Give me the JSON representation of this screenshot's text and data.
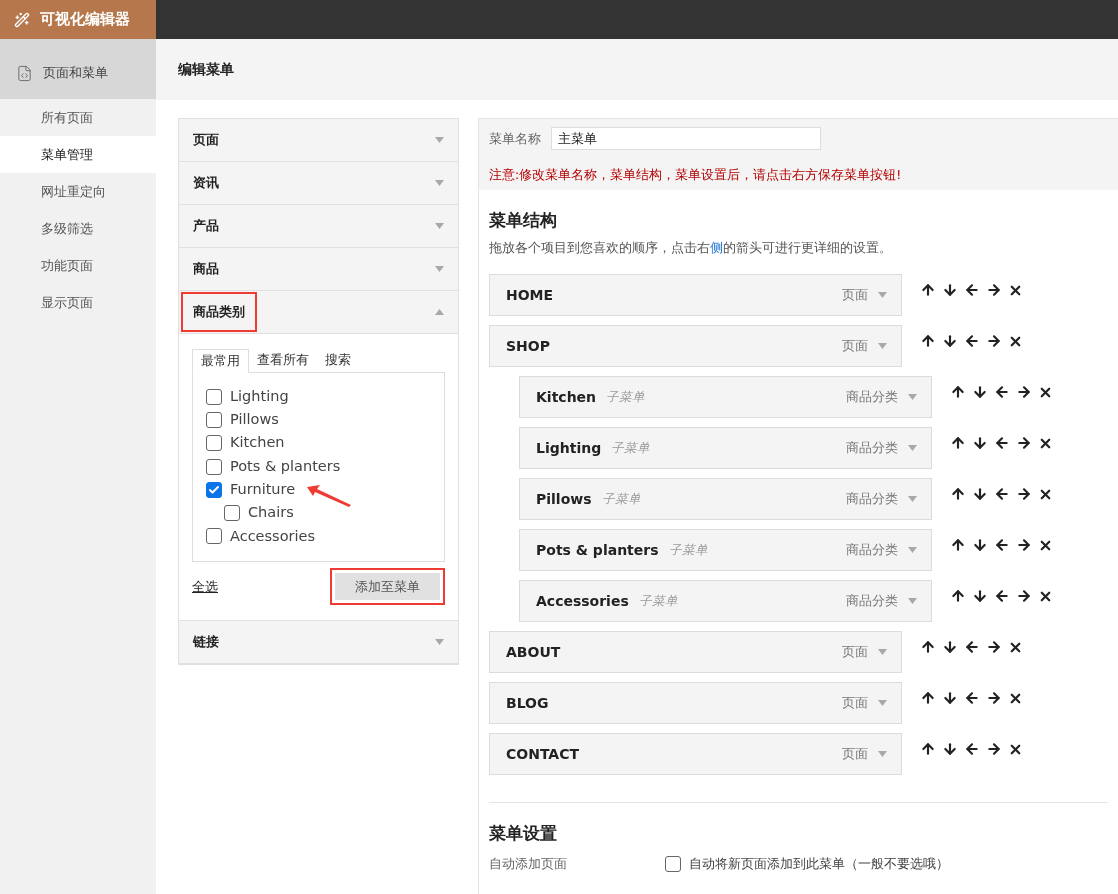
{
  "brand": {
    "title": "可视化编辑器"
  },
  "sidebar": {
    "header": "页面和菜单",
    "items": [
      {
        "label": "所有页面",
        "selected": false
      },
      {
        "label": "菜单管理",
        "selected": true
      },
      {
        "label": "网址重定向",
        "selected": false
      },
      {
        "label": "多级筛选",
        "selected": false
      },
      {
        "label": "功能页面",
        "selected": false
      },
      {
        "label": "显示页面",
        "selected": false
      }
    ]
  },
  "page_title": "编辑菜单",
  "sections": [
    {
      "label": "页面",
      "expanded": false,
      "highlighted": false
    },
    {
      "label": "资讯",
      "expanded": false,
      "highlighted": false
    },
    {
      "label": "产品",
      "expanded": false,
      "highlighted": false
    },
    {
      "label": "商品",
      "expanded": false,
      "highlighted": false
    },
    {
      "label": "商品类别",
      "expanded": true,
      "highlighted": true
    },
    {
      "label": "链接",
      "expanded": false,
      "highlighted": false
    }
  ],
  "category_panel": {
    "tabs": [
      {
        "label": "最常用",
        "selected": true
      },
      {
        "label": "查看所有",
        "selected": false
      },
      {
        "label": "搜索",
        "selected": false
      }
    ],
    "items": [
      {
        "label": "Lighting",
        "checked": false,
        "annotated": false
      },
      {
        "label": "Pillows",
        "checked": false,
        "annotated": false
      },
      {
        "label": "Kitchen",
        "checked": false,
        "annotated": false
      },
      {
        "label": "Pots & planters",
        "checked": false,
        "annotated": false
      },
      {
        "label": "Furniture",
        "checked": true,
        "annotated": true,
        "children": [
          {
            "label": "Chairs",
            "checked": false,
            "annotated": false
          }
        ]
      },
      {
        "label": "Accessories",
        "checked": false,
        "annotated": false
      }
    ],
    "select_all": "全选",
    "add_button": {
      "label": "添加至菜单",
      "highlighted": true
    }
  },
  "menu_name": {
    "label": "菜单名称",
    "value": "主菜单"
  },
  "notice": "注意:修改菜单名称，菜单结构，菜单设置后，请点击右方保存菜单按钮!",
  "structure": {
    "title": "菜单结构",
    "hint_before": "拖放各个项目到您喜欢的顺序，点击右",
    "hint_link": "侧",
    "hint_after": "的箭头可进行更详细的设置。",
    "items": [
      {
        "label": "HOME",
        "type": "页面"
      },
      {
        "label": "SHOP",
        "type": "页面",
        "children": [
          {
            "label": "Kitchen",
            "sub": "子菜单",
            "type": "商品分类"
          },
          {
            "label": "Lighting",
            "sub": "子菜单",
            "type": "商品分类"
          },
          {
            "label": "Pillows",
            "sub": "子菜单",
            "type": "商品分类"
          },
          {
            "label": "Pots & planters",
            "sub": "子菜单",
            "type": "商品分类"
          },
          {
            "label": "Accessories",
            "sub": "子菜单",
            "type": "商品分类"
          }
        ]
      },
      {
        "label": "ABOUT",
        "type": "页面"
      },
      {
        "label": "BLOG",
        "type": "页面"
      },
      {
        "label": "CONTACT",
        "type": "页面"
      }
    ]
  },
  "settings": {
    "title": "菜单设置",
    "row_label": "自动添加页面",
    "option": {
      "label": "自动将新页面添加到此菜单（一般不要选哦）",
      "checked": false
    }
  }
}
